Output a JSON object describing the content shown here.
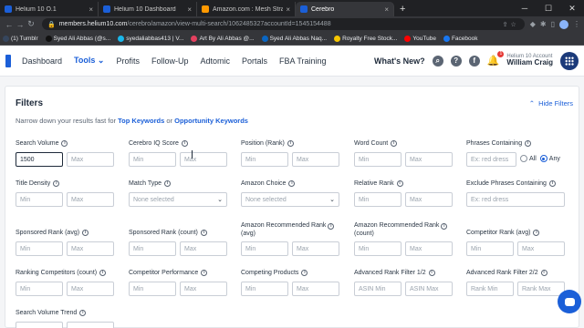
{
  "browser": {
    "tabs": [
      {
        "title": "Helium 10 O.1",
        "color": "#1b5fd8",
        "active": false
      },
      {
        "title": "Helium 10 Dashboard",
        "color": "#1b5fd8",
        "active": false
      },
      {
        "title": "Amazon.com : Mesh Strainer",
        "color": "#ff9900",
        "active": false
      },
      {
        "title": "Cerebro",
        "color": "#1b5fd8",
        "active": true
      }
    ],
    "url_host": "members.helium10.com",
    "url_path": "/cerebro/amazon/view-multi-search/1062485327accountId=1545154488",
    "bookmarks": [
      {
        "label": "(1) Tumblr",
        "color": "#36465d"
      },
      {
        "label": "Syed Ali Abbas (@s...",
        "color": "#111"
      },
      {
        "label": "syedaliabbas413 | V...",
        "color": "#1ab7ea"
      },
      {
        "label": "Art By Ali Abbas @...",
        "color": "#e4405f"
      },
      {
        "label": "Syed Ali Abbas Naq...",
        "color": "#0a66c2"
      },
      {
        "label": "Royalty Free Stock...",
        "color": "#f7c600"
      },
      {
        "label": "YouTube",
        "color": "#ff0000"
      },
      {
        "label": "Facebook",
        "color": "#1877f2"
      }
    ]
  },
  "header": {
    "nav": [
      "Dashboard",
      "Tools",
      "Profits",
      "Follow-Up",
      "Adtomic",
      "Portals",
      "FBA Training"
    ],
    "whats_new": "What's New?",
    "notification_count": "1",
    "account_label": "Helium 10 Account",
    "account_name": "William Craig"
  },
  "filters": {
    "title": "Filters",
    "hide_label": "Hide Filters",
    "subtitle_prefix": "Narrow down your results fast for",
    "link1": "Top Keywords",
    "subtitle_or": "or",
    "link2": "Opportunity Keywords",
    "fields": {
      "search_volume": {
        "label": "Search Volume",
        "min": "1500",
        "max": "Max"
      },
      "cerebro_iq": {
        "label": "Cerebro IQ Score",
        "min": "Min",
        "max": "Max"
      },
      "position": {
        "label": "Position (Rank)",
        "min": "Min",
        "max": "Max"
      },
      "word_count": {
        "label": "Word Count",
        "min": "Min",
        "max": "Max"
      },
      "phrases_containing": {
        "label": "Phrases Containing",
        "placeholder": "Ex: red dress",
        "opt_all": "All",
        "opt_any": "Any"
      },
      "title_density": {
        "label": "Title Density",
        "min": "Min",
        "max": "Max"
      },
      "match_type": {
        "label": "Match Type",
        "selected": "None selected"
      },
      "amazon_choice": {
        "label": "Amazon Choice",
        "selected": "None selected"
      },
      "relative_rank": {
        "label": "Relative Rank",
        "min": "Min",
        "max": "Max"
      },
      "exclude_phrases": {
        "label": "Exclude Phrases Containing",
        "placeholder": "Ex: red dress"
      },
      "sponsored_avg": {
        "label": "Sponsored Rank (avg)",
        "min": "Min",
        "max": "Max"
      },
      "sponsored_count": {
        "label": "Sponsored Rank (count)",
        "min": "Min",
        "max": "Max"
      },
      "amz_rec_avg": {
        "label1": "Amazon Recommended Rank",
        "label2": "(avg)",
        "min": "Min",
        "max": "Max"
      },
      "amz_rec_count": {
        "label1": "Amazon Recommended Rank",
        "label2": "(count)",
        "min": "Min",
        "max": "Max"
      },
      "competitor_avg": {
        "label": "Competitor Rank (avg)",
        "min": "Min",
        "max": "Max"
      },
      "ranking_competitors": {
        "label": "Ranking Competitors (count)",
        "min": "Min",
        "max": "Max"
      },
      "competitor_perf": {
        "label": "Competitor Performance",
        "min": "Min",
        "max": "Max"
      },
      "competing_products": {
        "label": "Competing Products",
        "min": "Min",
        "max": "Max"
      },
      "adv_rank_1_2": {
        "label": "Advanced Rank Filter 1/2",
        "min": "ASIN Min",
        "max": "ASIN Max"
      },
      "adv_rank_2_2": {
        "label": "Advanced Rank Filter 2/2",
        "min": "Rank Min",
        "max": "Rank Max"
      },
      "search_volume_trend": {
        "label": "Search Volume Trend"
      }
    }
  }
}
